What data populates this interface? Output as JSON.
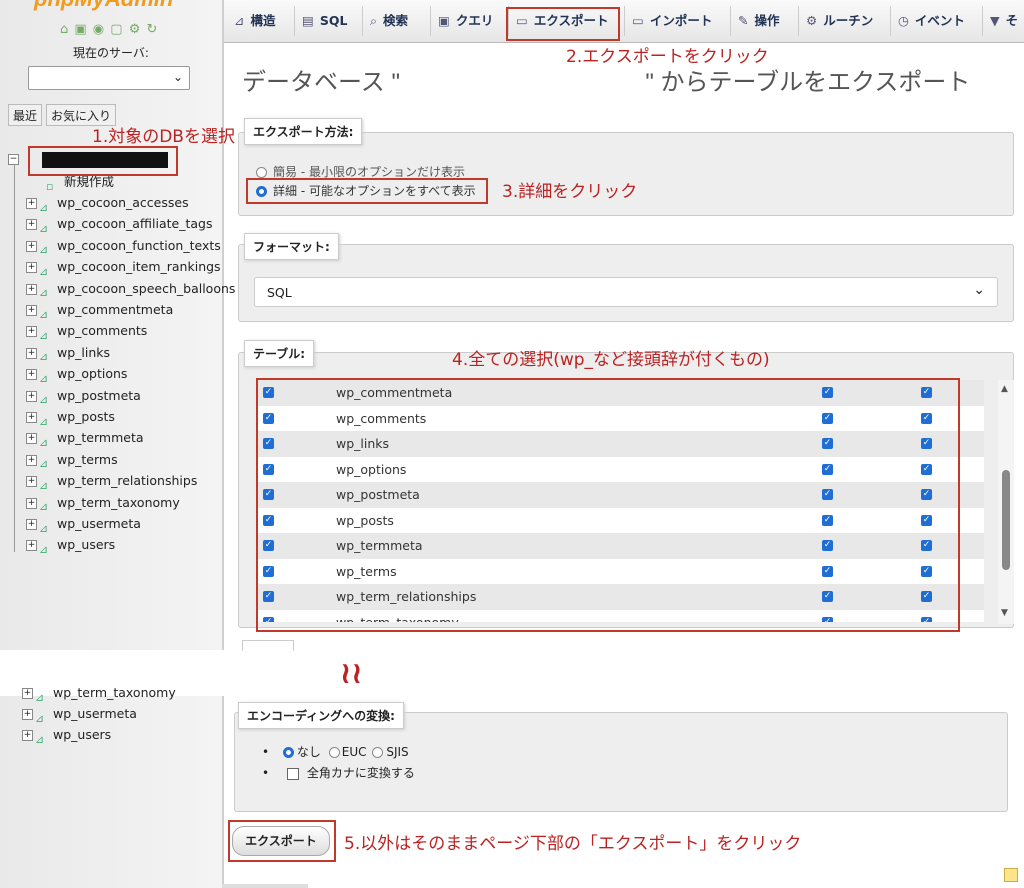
{
  "sidebar": {
    "logo": "phpMyAdmin",
    "logo_icons": "⌂ ▣ ◉ ▢ ⚙ ↻",
    "server_label": "現在のサーバ:",
    "server_value": "",
    "btn_recent": "最近",
    "btn_favorites": "お気に入り",
    "db_new": "新規作成",
    "tables": [
      "wp_cocoon_accesses",
      "wp_cocoon_affiliate_tags",
      "wp_cocoon_function_texts",
      "wp_cocoon_item_rankings",
      "wp_cocoon_speech_balloons",
      "wp_commentmeta",
      "wp_comments",
      "wp_links",
      "wp_options",
      "wp_postmeta",
      "wp_posts",
      "wp_termmeta",
      "wp_terms",
      "wp_term_relationships",
      "wp_term_taxonomy",
      "wp_usermeta",
      "wp_users"
    ],
    "lower_tables": [
      "wp_term_taxonomy",
      "wp_usermeta",
      "wp_users"
    ]
  },
  "tabs": [
    {
      "icon": "structure-icon",
      "label": "構造"
    },
    {
      "icon": "sql-icon",
      "label": "SQL"
    },
    {
      "icon": "search-icon",
      "label": "検索"
    },
    {
      "icon": "query-icon",
      "label": "クエリ"
    },
    {
      "icon": "export-icon",
      "label": "エクスポート"
    },
    {
      "icon": "import-icon",
      "label": "インポート"
    },
    {
      "icon": "operations-icon",
      "label": "操作"
    },
    {
      "icon": "routines-icon",
      "label": "ルーチン"
    },
    {
      "icon": "events-icon",
      "label": "イベント"
    },
    {
      "icon": "more-icon",
      "label": "そ"
    }
  ],
  "page_title_left": "データベース \"",
  "page_title_right": "\" からテーブルをエクスポート",
  "export_method": {
    "legend": "エクスポート方法:",
    "option_quick": "簡易 - 最小限のオプションだけ表示",
    "option_custom": "詳細 - 可能なオプションをすべて表示",
    "selected": "custom"
  },
  "format": {
    "legend": "フォーマット:",
    "value": "SQL"
  },
  "tables_section": {
    "legend": "テーブル:",
    "rows": [
      "wp_commentmeta",
      "wp_comments",
      "wp_links",
      "wp_options",
      "wp_postmeta",
      "wp_posts",
      "wp_termmeta",
      "wp_terms",
      "wp_term_relationships",
      "wp_term_taxonomy"
    ]
  },
  "encoding": {
    "legend": "エンコーディングへの変換:",
    "opt_none": "なし",
    "opt_euc": "EUC",
    "opt_sjis": "SJIS",
    "kana_label": "全角カナに変換する"
  },
  "export_button": "エクスポート",
  "separator_mark": "≀≀",
  "annotations": {
    "a1": "1.対象のDBを選択",
    "a2": "2.エクスポートをクリック",
    "a3": "3.詳細をクリック",
    "a4": "4.全ての選択(wp_など接頭辞が付くもの)",
    "a5": "5.以外はそのままページ下部の「エクスポート」をクリック"
  },
  "colors": {
    "annotation": "#c0392b",
    "accent": "#1f6ed6",
    "logo": "#f29a1c"
  }
}
